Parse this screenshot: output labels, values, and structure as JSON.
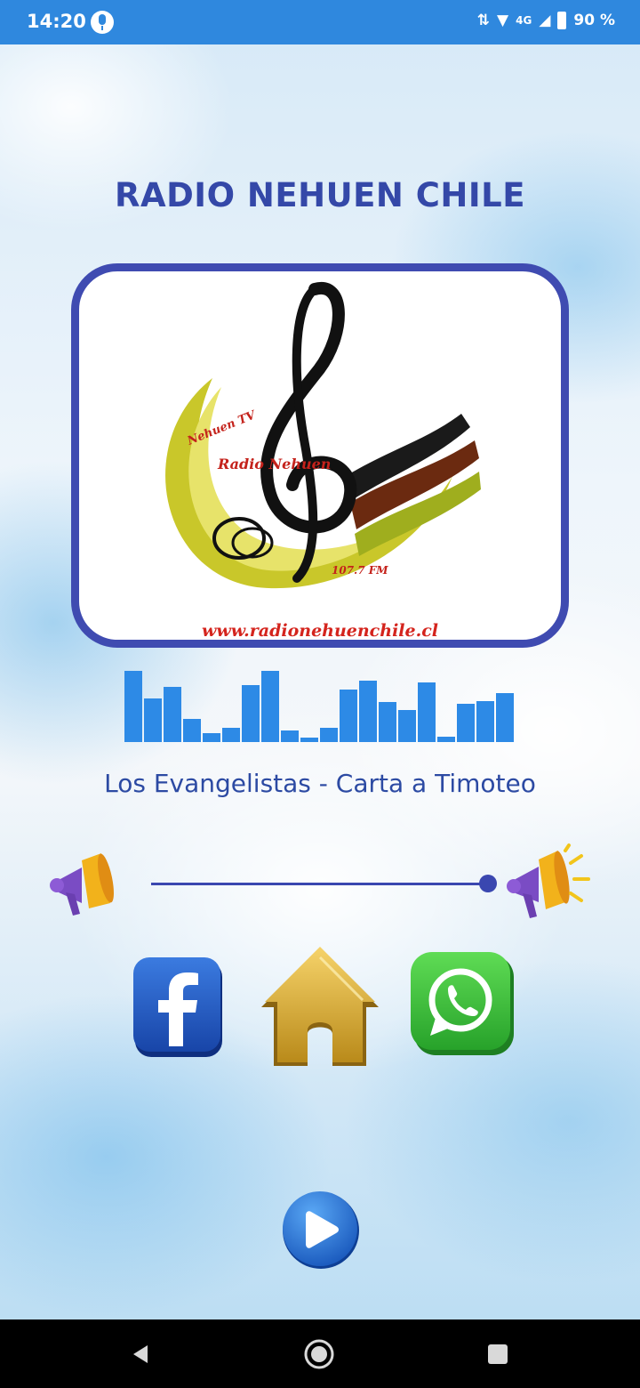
{
  "status_bar": {
    "time": "14:20",
    "network": "4G",
    "battery": "90 %"
  },
  "app": {
    "title": "RADIO NEHUEN CHILE"
  },
  "logo": {
    "tv_label": "Nehuen TV",
    "radio_label": "Radio Nehuen",
    "frequency": "107.7 FM",
    "url": "www.radionehuenchile.cl"
  },
  "player": {
    "track_title": "Los Evangelistas - Carta a Timoteo",
    "volume_level": 1.0,
    "equalizer_levels": [
      0.98,
      0.6,
      0.75,
      0.32,
      0.12,
      0.2,
      0.78,
      0.97,
      0.16,
      0.06,
      0.2,
      0.72,
      0.84,
      0.55,
      0.44,
      0.82,
      0.07,
      0.52,
      0.56,
      0.67
    ]
  },
  "actions": {
    "facebook": "facebook-icon",
    "home": "home-icon",
    "whatsapp": "whatsapp-icon",
    "play": "play-icon"
  },
  "colors": {
    "status_bar": "#2f88de",
    "title": "#3448a8",
    "card_border": "#3f4bb1",
    "equalizer": "#2d8ae6",
    "track_text": "#2c4aa3"
  }
}
